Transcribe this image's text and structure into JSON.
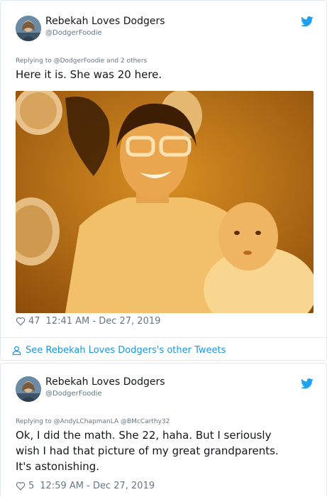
{
  "tweets": [
    {
      "author_name": "Rebekah Loves Dodgers",
      "author_handle": "@DodgerFoodie",
      "replying_to": "Replying to @DodgerFoodie and 2 others",
      "text": "Here it is. She was 20 here.",
      "likes": "47",
      "timestamp": "12:41 AM - Dec 27, 2019",
      "see_more": "See Rebekah Loves Dodgers's other Tweets"
    },
    {
      "author_name": "Rebekah Loves Dodgers",
      "author_handle": "@DodgerFoodie",
      "replying_to": "Replying to @AndyLChapmanLA @BMcCarthy32",
      "text_lines": [
        "Ok, I did the math. She 22, haha. But I seriously",
        "wish I had that picture of my great grandparents.",
        "It's astonishing."
      ],
      "likes": "5",
      "timestamp": "12:59 AM - Dec 27, 2019"
    }
  ],
  "colors": {
    "twitter_blue": "#1da1f2",
    "link_blue": "#1b95e0",
    "muted_text": "#657786",
    "photo_sepia": "#c9821c"
  },
  "icons": {
    "brand": "twitter-bird-icon",
    "like": "heart-outline-icon",
    "profile": "person-icon"
  }
}
